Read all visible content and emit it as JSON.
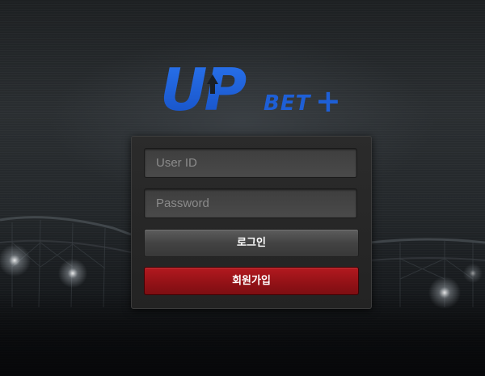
{
  "brand": {
    "logo_main": "UP",
    "logo_sub": "BET",
    "logo_plus": "+"
  },
  "login_form": {
    "user_id_placeholder": "User ID",
    "password_placeholder": "Password",
    "login_label": "로그인",
    "signup_label": "회원가입"
  },
  "colors": {
    "logo_blue": "#1e5fd6",
    "signup_red": "#9b151a",
    "login_gray": "#4a4a4a"
  }
}
